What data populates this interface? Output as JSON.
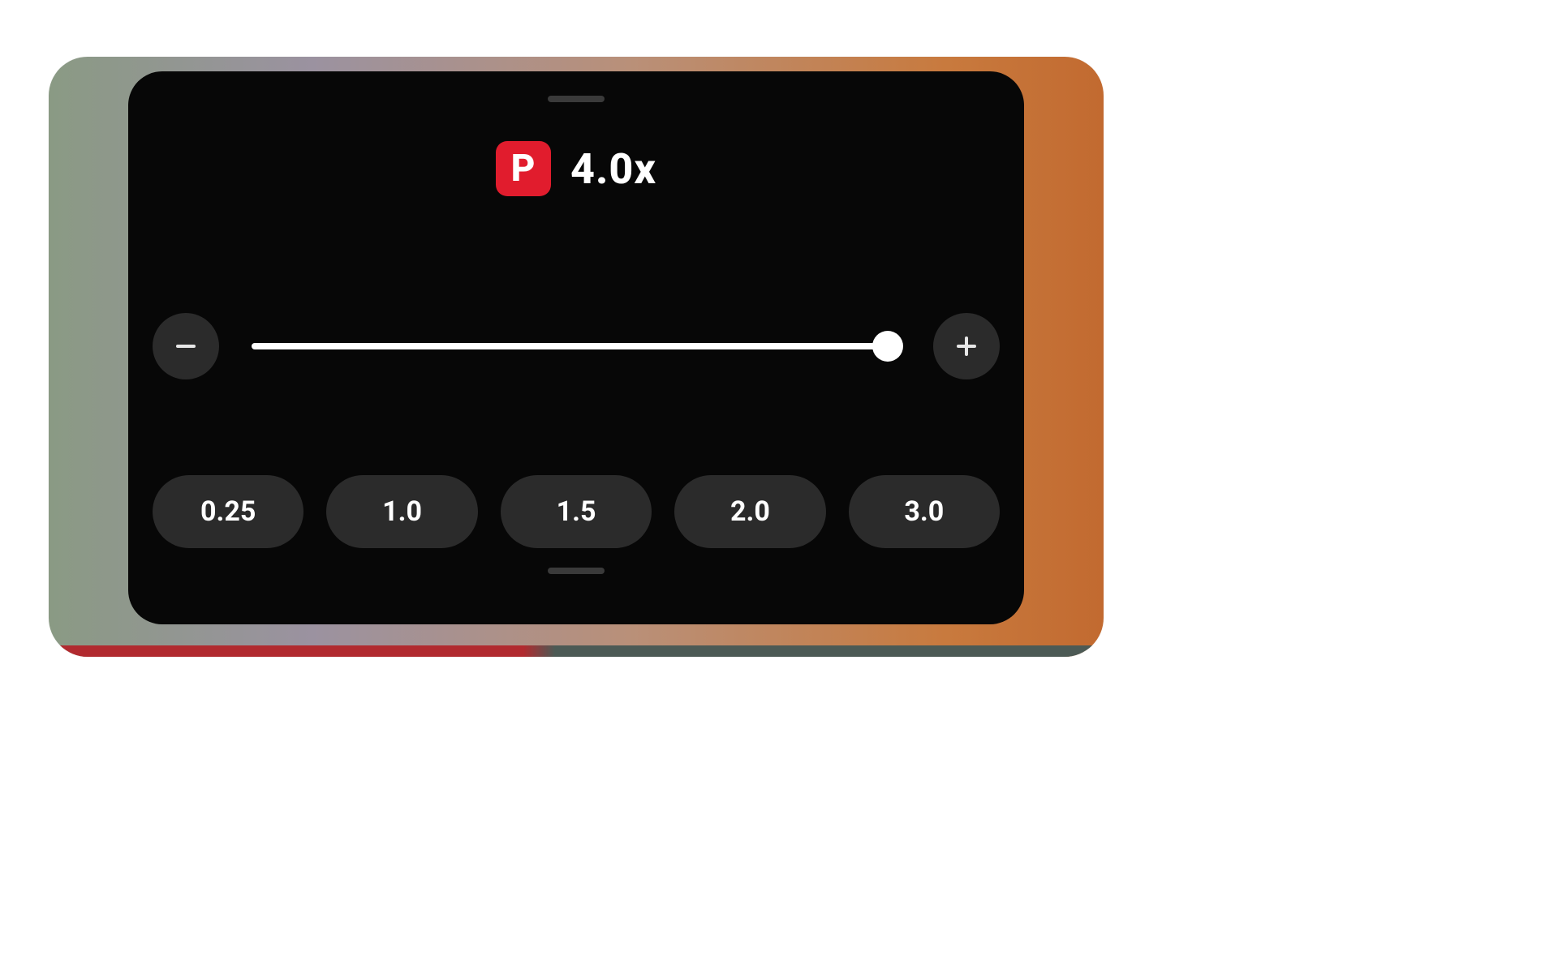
{
  "speed": {
    "badge_letter": "P",
    "current_label": "4.0x",
    "slider_percent": 98
  },
  "controls": {
    "minus_icon": "minus-icon",
    "plus_icon": "plus-icon"
  },
  "presets": [
    {
      "label": "0.25"
    },
    {
      "label": "1.0"
    },
    {
      "label": "1.5"
    },
    {
      "label": "2.0"
    },
    {
      "label": "3.0"
    }
  ],
  "colors": {
    "accent_red": "#e11c2d",
    "panel_bg": "#070707",
    "chip_bg": "#2b2b2b"
  }
}
